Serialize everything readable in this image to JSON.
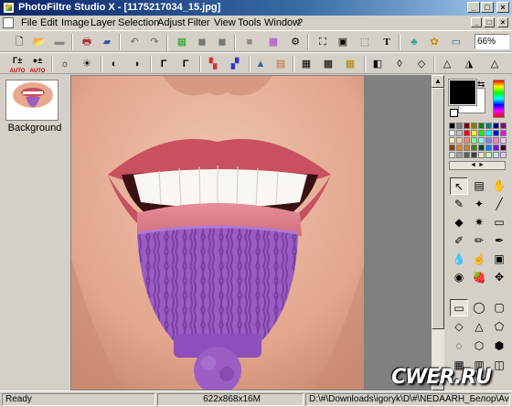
{
  "window": {
    "title": "PhotoFiltre Studio X - [1175217034_15.jpg]",
    "controls": [
      "_",
      "□",
      "×"
    ]
  },
  "menu": {
    "items": [
      "File",
      "Edit",
      "Image",
      "Layer",
      "Selection",
      "Adjust",
      "Filter",
      "View",
      "Tools",
      "Window",
      "?"
    ],
    "doc_controls": [
      "_",
      "□",
      "×"
    ]
  },
  "toolbar1": {
    "icons": [
      "new-icon",
      "open-icon",
      "save-icon",
      "print-icon",
      "scan-icon",
      "undo-icon",
      "redo-icon",
      "paste-icon",
      "copy-layer-icon",
      "duplicate-icon",
      "stop-icon",
      "grid-icon",
      "automate-icon",
      "resize-icon",
      "canvas-icon",
      "crop-icon",
      "text-icon",
      "tree-icon",
      "brush-stamp-icon",
      "screen-icon"
    ],
    "zoom": "66%"
  },
  "toolbar2": {
    "gamma_plus_label": "Γ±",
    "auto_label": "AUTO",
    "gamma_label": "Γ"
  },
  "layers": {
    "items": [
      {
        "name": "Background"
      }
    ]
  },
  "colors": {
    "foreground": "#000000",
    "background": "#ffffff",
    "palette": [
      "#000000",
      "#808080",
      "#800000",
      "#808000",
      "#008000",
      "#008080",
      "#000080",
      "#800080",
      "#ffffff",
      "#c0c0c0",
      "#ff0000",
      "#ffff00",
      "#00ff00",
      "#00ffff",
      "#0000ff",
      "#ff00ff",
      "#fff0b0",
      "#ffc8a0",
      "#ff8080",
      "#80ff80",
      "#80ffff",
      "#8080ff",
      "#ff80c0",
      "#ffc0ff",
      "#804000",
      "#ff8000",
      "#c08040",
      "#408000",
      "#004040",
      "#0080ff",
      "#8000ff",
      "#400040",
      "#e0e0e0",
      "#a0a0a0",
      "#606060",
      "#404040",
      "#ffe0c0",
      "#c0ffc0",
      "#c0e0ff",
      "#e0c0ff"
    ]
  },
  "status": {
    "ready": "Ready",
    "dimensions": "622x868x16M",
    "path": "D:\\#\\Downloads\\igoryk\\D\\#\\NEDAARH_Белор\\Avatars"
  },
  "watermark": "CWER.RU"
}
